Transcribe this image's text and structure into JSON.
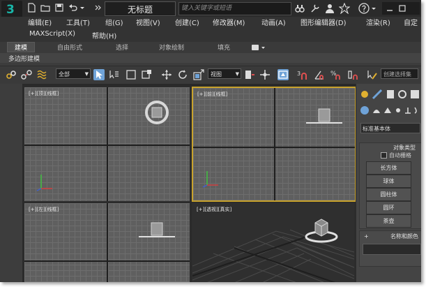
{
  "titlebar": {
    "app_logo": "3",
    "title": "无标题",
    "search_placeholder": "键入关键字或短语"
  },
  "menu": {
    "row1": [
      "编辑(E)",
      "工具(T)",
      "组(G)",
      "视图(V)",
      "创建(C)",
      "修改器(M)",
      "动画(A)",
      "图形编辑器(D)",
      "渲染(R)",
      "自定"
    ],
    "row2": [
      "MAXScript(X)",
      "帮助(H)"
    ]
  },
  "ribbon": {
    "tabs": [
      "建模",
      "自由形式",
      "选择",
      "对象绘制",
      "填充"
    ],
    "active_tab": "建模",
    "panel_label": "多边形建模"
  },
  "toolbar": {
    "selection_filter": "全部",
    "reference_coord": "视图",
    "named_selection_placeholder": "创建选择集"
  },
  "viewports": {
    "top_left_label": "[+][顶][线框]",
    "top_right_label": "[+][前][线框]",
    "bottom_left_label": "[+][左][线框]",
    "bottom_right_label": "[+][透视][真实]"
  },
  "command_panel": {
    "category_select": "标准基本体",
    "section_object_type": "对象类型",
    "autogrid_label": "自动栅格",
    "object_buttons": [
      "长方体",
      "球体",
      "圆柱体",
      "圆环",
      "茶壶"
    ],
    "section_name_color": "名称和颜色"
  },
  "colors": {
    "viewport_bg": "#5f5f5f",
    "active_viewport_border": "#c8a22c",
    "ui_dark": "#3c3c3c",
    "logo_teal": "#19b5a8"
  }
}
